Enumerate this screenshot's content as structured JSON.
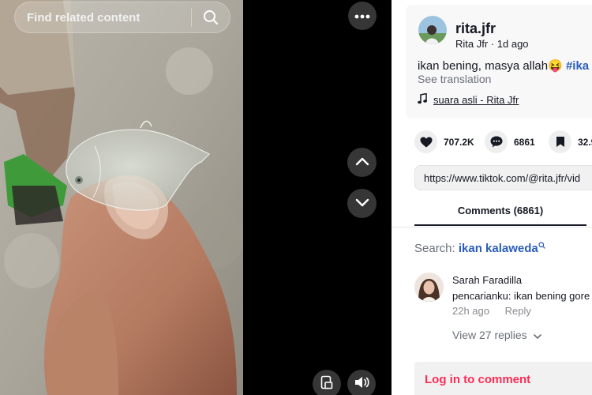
{
  "video": {
    "search_placeholder": "Find related content",
    "icons": {
      "search": "search-icon",
      "more": "more-dots-icon",
      "prev": "chevron-up-icon",
      "next": "chevron-down-icon",
      "mini_player": "mini-player-icon",
      "volume": "volume-icon"
    }
  },
  "description": {
    "username": "rita.jfr",
    "author_name": "Rita Jfr",
    "time_ago": "1d ago",
    "caption_text": "ikan bening, masya allah😝",
    "caption_hashtag": "#ika",
    "see_translation": "See translation",
    "music": "suara asli - Rita Jfr"
  },
  "stats": {
    "likes": "707.2K",
    "comments": "6861",
    "saves": "32.9"
  },
  "link": "https://www.tiktok.com/@rita.jfr/vid",
  "tabs": {
    "comments_label": "Comments (6861)"
  },
  "search_suggestion": {
    "prefix": "Search:",
    "term": "ikan kalaweda"
  },
  "comment": {
    "name": "Sarah Faradilla",
    "text": "pencarianku: ikan bening gore",
    "time": "22h ago",
    "reply_label": "Reply",
    "view_replies": "View 27 replies"
  },
  "login_label": "Log in to comment",
  "colors": {
    "accent": "#fe2c55",
    "link": "#2b5db9",
    "text": "#161823"
  }
}
